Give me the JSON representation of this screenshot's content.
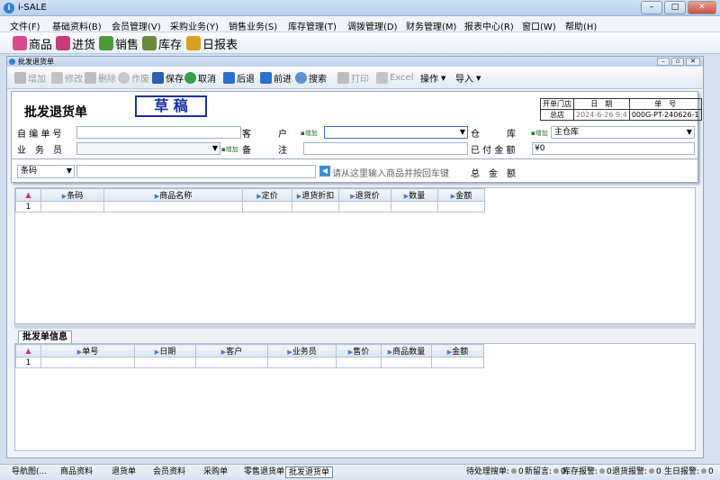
{
  "app": {
    "title": "i-SALE"
  },
  "menu": [
    "文件(F)",
    "基础资料(B)",
    "会员管理(V)",
    "采购业务(Y)",
    "销售业务(S)",
    "库存管理(T)",
    "调拨管理(D)",
    "财务管理(M)",
    "报表中心(R)",
    "窗口(W)",
    "帮助(H)"
  ],
  "quickbar": [
    {
      "label": "商品",
      "icon": "goods-icon",
      "color": "#d94a8c"
    },
    {
      "label": "进货",
      "icon": "purchase-icon",
      "color": "#c83a7a"
    },
    {
      "label": "销售",
      "icon": "sales-icon",
      "color": "#4a9a3a"
    },
    {
      "label": "库存",
      "icon": "inventory-icon",
      "color": "#6a8a3a"
    },
    {
      "label": "日报表",
      "icon": "report-icon",
      "color": "#d9a020"
    }
  ],
  "window": {
    "title": "批发退货单"
  },
  "toolbar": {
    "add": "增加",
    "edit": "修改",
    "delete": "删除",
    "void": "作废",
    "save": "保存",
    "cancel": "取消",
    "prev": "后退",
    "next": "前进",
    "search": "搜索",
    "print": "打印",
    "excel": "Excel",
    "ops": "操作",
    "import": "导入"
  },
  "form": {
    "heading": "批发退货单",
    "stamp": "草 稿",
    "info_headers": [
      "开单门店",
      "日　期",
      "单　号"
    ],
    "info_values": [
      "总店",
      "2024-6-26 9:4",
      "000G-PT-240626-1"
    ],
    "labels": {
      "self_no": "自 编 单 号",
      "customer": "客　　　户",
      "warehouse": "仓　　　库",
      "salesman": "业　务　员",
      "remark": "备　　　注",
      "paid": "已 付 金 额",
      "total": "总　金　额"
    },
    "add_tag": "增加",
    "warehouse_value": "主仓库",
    "paid_value": "¥0",
    "barcode_mode": "条码",
    "barcode_hint": "请从这里输入商品并按回车键"
  },
  "grid1": {
    "headers": [
      "条码",
      "商品名称",
      "定价",
      "退货折扣",
      "退货价",
      "数量",
      "金额"
    ],
    "rows": [
      [
        "1",
        "",
        "",
        "",
        "",
        "",
        "",
        ""
      ]
    ]
  },
  "grid2": {
    "tab": "批发单信息",
    "headers": [
      "单号",
      "日期",
      "客户",
      "业务员",
      "售价",
      "商品数量",
      "金额"
    ],
    "rows": [
      [
        "1",
        "",
        "",
        "",
        "",
        "",
        "",
        ""
      ]
    ]
  },
  "status": {
    "tabs": [
      "导航图(...",
      "商品资料",
      "退货单",
      "会员资料",
      "采购单",
      "零售退货单",
      "批发退货单"
    ],
    "active": 6,
    "indicators": [
      "待处理搜单:",
      "新留言:",
      "库存报警:",
      "退货报警:",
      "生日报警:"
    ],
    "counts": [
      "0",
      "0",
      "0",
      "0",
      "0"
    ]
  },
  "colors": {
    "accent": "#3a7bd5",
    "stamp": "#1a2fa8"
  }
}
